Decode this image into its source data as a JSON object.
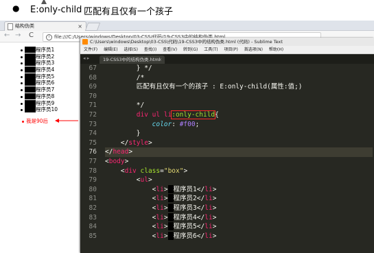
{
  "doc": {
    "bullet": "●",
    "selector": "E:only-child",
    "description": "匹配有且仅有一个孩子",
    "return_mark": "↵"
  },
  "browser": {
    "tab_title": "结构伪类",
    "tab_close": "×",
    "nav_back": "←",
    "nav_forward": "→",
    "nav_reload": "C",
    "info_icon": "i",
    "url": "file:///C:/Users/windows/Desktop/03-CSS/代码/19-CSS3中的结构伪类.html"
  },
  "page": {
    "items": [
      "程序员1",
      "程序员2",
      "程序员3",
      "程序员4",
      "程序员5",
      "程序员6",
      "程序员7",
      "程序员8",
      "程序员9",
      "程序员10"
    ],
    "last_item": "我是90后",
    "highlight_color": "#ff0000"
  },
  "sublime": {
    "title": "C:\\Users\\windows\\Desktop\\03-CSS\\代码\\19-CSS3中的结构伪类.html (代码) - Sublime Text",
    "menu": [
      "文件(F)",
      "编辑(E)",
      "选择(S)",
      "查找(I)",
      "查看(V)",
      "转到(G)",
      "工具(T)",
      "项目(P)",
      "首选项(N)",
      "帮助(H)"
    ],
    "nav_arrows": "◂ ▸",
    "tab_name": "19-CSS3中的结构伪类.html",
    "tab_close": "×",
    "line_numbers": [
      "67",
      "68",
      "69",
      "70",
      "71",
      "72",
      "73",
      "74",
      "75",
      "76",
      "77",
      "78",
      "79",
      "80",
      "81",
      "82",
      "83",
      "84",
      "85"
    ],
    "current_line": "76",
    "code": {
      "l67": "        } */",
      "l68": "        /*",
      "l69": "        匹配有且仅有一个的孩子 : E:only-child(属性:值;)",
      "l71": "        */",
      "l72_sel": "        div ul li",
      "l72_hl": ":only-child",
      "l72_end": "{",
      "l73_prop": "            color",
      "l73_sep": ": ",
      "l73_val": "#f00",
      "l73_end": ";",
      "l74": "        }",
      "l75_open": "    </",
      "l75_tag": "style",
      "l75_close": ">",
      "l76_open": "</",
      "l76_tag": "head",
      "l76_close": ">",
      "l77_open": "<",
      "l77_tag": "body",
      "l77_close": ">",
      "l78_indent": "    <",
      "l78_tag": "div",
      "l78_attr": " class",
      "l78_eq": "=",
      "l78_str": "\"box\"",
      "l78_close": ">",
      "l79_indent": "        <",
      "l79_tag": "ul",
      "l79_close": ">",
      "li_open_tag": "li",
      "li_rows": [
        "程序员1",
        "程序员2",
        "程序员3",
        "程序员4",
        "程序员5",
        "程序员6"
      ]
    }
  }
}
